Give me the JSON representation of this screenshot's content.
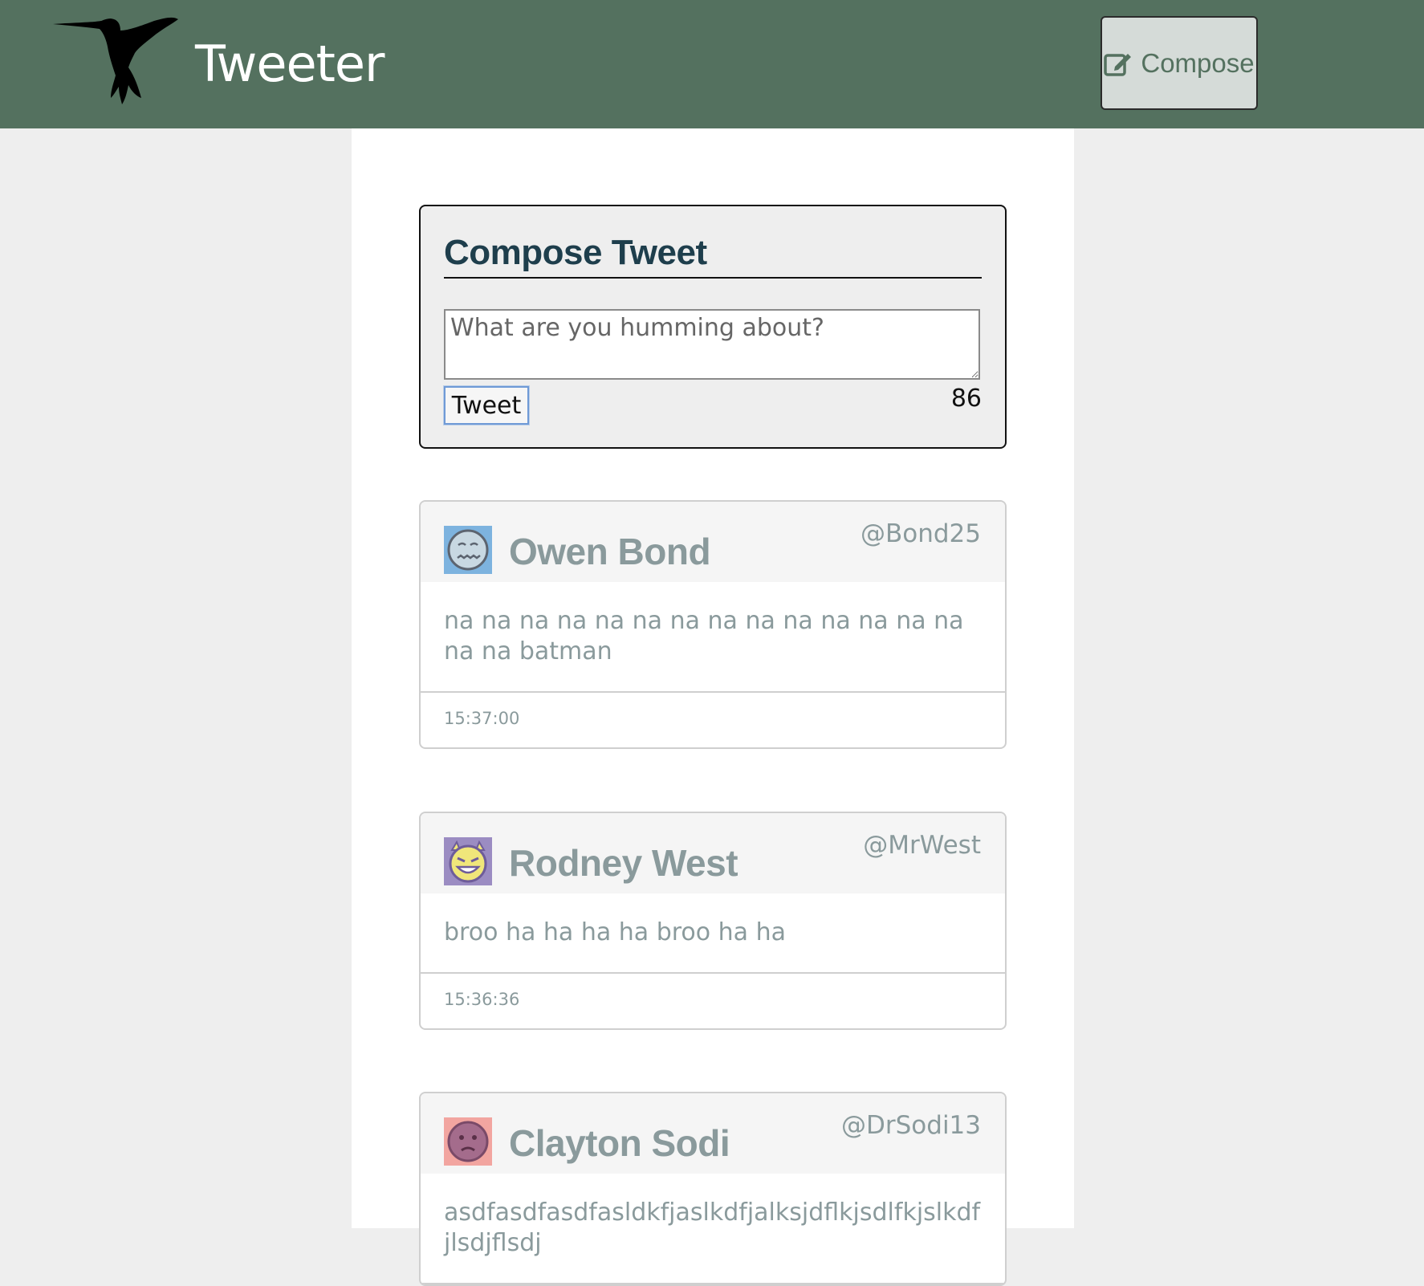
{
  "nav": {
    "brand": "Tweeter",
    "compose_label": "Compose",
    "colors": {
      "bar": "#54715f",
      "button_bg": "#d5dbd8"
    }
  },
  "compose": {
    "title": "Compose Tweet",
    "placeholder": "What are you humming about?",
    "submit_label": "Tweet",
    "counter": "86"
  },
  "tweets": [
    {
      "name": "Owen Bond",
      "handle": "@Bond25",
      "text": "na na na na na na na na na na na na na na na na batman",
      "time": "15:37:00",
      "avatar": {
        "icon": "grimace-face-icon",
        "bg": "#7db3df",
        "face": "#c8d8e2"
      }
    },
    {
      "name": "Rodney West",
      "handle": "@MrWest",
      "text": "broo ha ha ha ha broo ha ha",
      "time": "15:36:36",
      "avatar": {
        "icon": "devil-face-icon",
        "bg": "#9b8cc2",
        "face": "#f0e67a"
      }
    },
    {
      "name": "Clayton Sodi",
      "handle": "@DrSodi13",
      "text": "asdfasdfasdfasldkfjaslkdfjalksjdflkjsdlfkjslkdfjlsdjflsdj",
      "time": "",
      "avatar": {
        "icon": "sad-face-icon",
        "bg": "#f2a5a0",
        "face": "#a46c8c"
      }
    }
  ]
}
